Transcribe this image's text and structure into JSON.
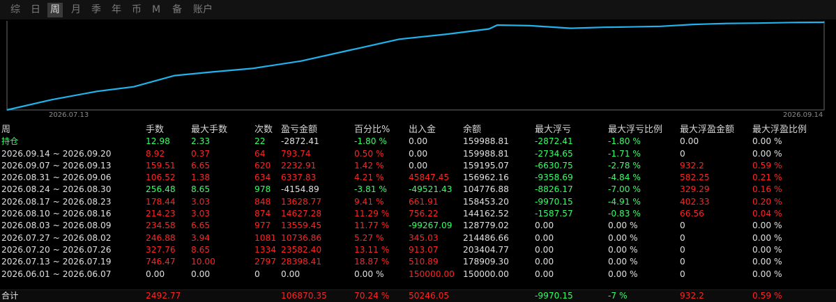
{
  "tabs": [
    {
      "label": "综",
      "active": false
    },
    {
      "label": "日",
      "active": false
    },
    {
      "label": "周",
      "active": true
    },
    {
      "label": "月",
      "active": false
    },
    {
      "label": "季",
      "active": false
    },
    {
      "label": "年",
      "active": false
    },
    {
      "label": "币",
      "active": false
    },
    {
      "label": "M",
      "active": false
    },
    {
      "label": "备",
      "active": false
    },
    {
      "label": "账户",
      "active": false
    }
  ],
  "chart_data": {
    "type": "line",
    "x_tick_labels": [
      "2026.07.13",
      "2026.09.14"
    ],
    "line_color": "#1fb4ee",
    "series": [
      {
        "values": [
          150000,
          166000,
          178909,
          186000,
          203405,
          209000,
          214487,
          226000,
          243000,
          260000,
          268000,
          276000,
          282000,
          281000,
          277000,
          278500,
          279000,
          280000,
          283000,
          284500,
          285000,
          286000,
          286300
        ]
      }
    ],
    "x": [
      0,
      0.055,
      0.11,
      0.155,
      0.205,
      0.25,
      0.3,
      0.36,
      0.42,
      0.48,
      0.54,
      0.59,
      0.6,
      0.64,
      0.69,
      0.73,
      0.76,
      0.8,
      0.84,
      0.88,
      0.92,
      0.96,
      1.0
    ]
  },
  "table": {
    "headers": [
      "周",
      "手数",
      "最大手数",
      "次数",
      "盈亏金额",
      "百分比%",
      "出入金",
      "余额",
      "最大浮亏",
      "最大浮亏比例",
      "最大浮盈金额",
      "最大浮盈比例"
    ],
    "rows": [
      {
        "cells": [
          "持仓",
          "12.98",
          "2.33",
          "22",
          "-2872.41",
          "-1.80 %",
          "0.00",
          "159988.81",
          "-2872.41",
          "-1.80 %",
          "0.00",
          "0.00 %"
        ],
        "colors": [
          "green",
          "green",
          "green",
          "green",
          "white",
          "green",
          "white",
          "white",
          "green",
          "green",
          "white",
          "white"
        ]
      },
      {
        "cells": [
          "2026.09.14 ~ 2026.09.20",
          "8.92",
          "0.37",
          "64",
          "793.74",
          "0.50 %",
          "0.00",
          "159988.81",
          "-2734.65",
          "-1.71 %",
          "0",
          "0.00 %"
        ],
        "colors": [
          "white",
          "red",
          "red",
          "red",
          "red",
          "red",
          "white",
          "white",
          "green",
          "green",
          "white",
          "white"
        ]
      },
      {
        "cells": [
          "2026.09.07 ~ 2026.09.13",
          "159.51",
          "6.65",
          "620",
          "2232.91",
          "1.42 %",
          "0.00",
          "159195.07",
          "-6630.75",
          "-2.78 %",
          "932.2",
          "0.59 %"
        ],
        "colors": [
          "white",
          "red",
          "red",
          "red",
          "red",
          "red",
          "white",
          "white",
          "green",
          "green",
          "red",
          "red"
        ]
      },
      {
        "cells": [
          "2026.08.31 ~ 2026.09.06",
          "106.52",
          "1.38",
          "634",
          "6337.83",
          "4.21 %",
          "45847.45",
          "156962.16",
          "-9358.69",
          "-4.84 %",
          "582.25",
          "0.21 %"
        ],
        "colors": [
          "white",
          "red",
          "red",
          "red",
          "red",
          "red",
          "red",
          "white",
          "green",
          "green",
          "red",
          "red"
        ]
      },
      {
        "cells": [
          "2026.08.24 ~ 2026.08.30",
          "256.48",
          "8.65",
          "978",
          "-4154.89",
          "-3.81 %",
          "-49521.43",
          "104776.88",
          "-8826.17",
          "-7.00 %",
          "329.29",
          "0.16 %"
        ],
        "colors": [
          "white",
          "green",
          "green",
          "green",
          "white",
          "green",
          "green",
          "white",
          "green",
          "green",
          "red",
          "red"
        ]
      },
      {
        "cells": [
          "2026.08.17 ~ 2026.08.23",
          "178.44",
          "3.03",
          "848",
          "13628.77",
          "9.41 %",
          "661.91",
          "158453.20",
          "-9970.15",
          "-4.91 %",
          "402.33",
          "0.20 %"
        ],
        "colors": [
          "white",
          "red",
          "red",
          "red",
          "red",
          "red",
          "red",
          "white",
          "green",
          "green",
          "red",
          "red"
        ]
      },
      {
        "cells": [
          "2026.08.10 ~ 2026.08.16",
          "214.23",
          "3.03",
          "874",
          "14627.28",
          "11.29 %",
          "756.22",
          "144162.52",
          "-1587.57",
          "-0.83 %",
          "66.56",
          "0.04 %"
        ],
        "colors": [
          "white",
          "red",
          "red",
          "red",
          "red",
          "red",
          "red",
          "white",
          "green",
          "green",
          "red",
          "red"
        ]
      },
      {
        "cells": [
          "2026.08.03 ~ 2026.08.09",
          "234.58",
          "6.65",
          "977",
          "13559.45",
          "11.77 %",
          "-99267.09",
          "128779.02",
          "0.00",
          "0.00 %",
          "0",
          "0.00 %"
        ],
        "colors": [
          "white",
          "red",
          "red",
          "red",
          "red",
          "red",
          "green",
          "white",
          "white",
          "white",
          "white",
          "white"
        ]
      },
      {
        "cells": [
          "2026.07.27 ~ 2026.08.02",
          "246.88",
          "3.94",
          "1081",
          "10736.86",
          "5.27 %",
          "345.03",
          "214486.66",
          "0.00",
          "0.00 %",
          "0",
          "0.00 %"
        ],
        "colors": [
          "white",
          "red",
          "red",
          "red",
          "red",
          "red",
          "red",
          "white",
          "white",
          "white",
          "white",
          "white"
        ]
      },
      {
        "cells": [
          "2026.07.20 ~ 2026.07.26",
          "327.76",
          "8.65",
          "1334",
          "23582.40",
          "13.11 %",
          "913.07",
          "203404.77",
          "0.00",
          "0.00 %",
          "0",
          "0.00 %"
        ],
        "colors": [
          "white",
          "red",
          "red",
          "red",
          "red",
          "red",
          "red",
          "white",
          "white",
          "white",
          "white",
          "white"
        ]
      },
      {
        "cells": [
          "2026.07.13 ~ 2026.07.19",
          "746.47",
          "10.00",
          "2797",
          "28398.41",
          "18.87 %",
          "510.89",
          "178909.30",
          "0.00",
          "0.00 %",
          "0",
          "0.00 %"
        ],
        "colors": [
          "white",
          "red",
          "red",
          "red",
          "red",
          "red",
          "red",
          "white",
          "white",
          "white",
          "white",
          "white"
        ]
      },
      {
        "cells": [
          "2026.06.01 ~ 2026.06.07",
          "0.00",
          "0.00",
          "0",
          "0.00",
          "0.00 %",
          "150000.00",
          "150000.00",
          "0.00",
          "0.00 %",
          "0",
          "0.00 %"
        ],
        "colors": [
          "white",
          "white",
          "white",
          "white",
          "white",
          "white",
          "red",
          "white",
          "white",
          "white",
          "white",
          "white"
        ]
      }
    ],
    "total": {
      "cells": [
        "合计",
        "2492.77",
        "",
        "",
        "106870.35",
        "70.24 %",
        "50246.05",
        "",
        "-9970.15",
        "-7 %",
        "932.2",
        "0.59 %"
      ],
      "colors": [
        "white",
        "red",
        "white",
        "white",
        "red",
        "red",
        "red",
        "white",
        "green",
        "green",
        "red",
        "red"
      ]
    }
  },
  "colors": {
    "red": "#ff2424",
    "green": "#33ff66",
    "white": "#e0e0e0",
    "line": "#1fb4ee"
  }
}
